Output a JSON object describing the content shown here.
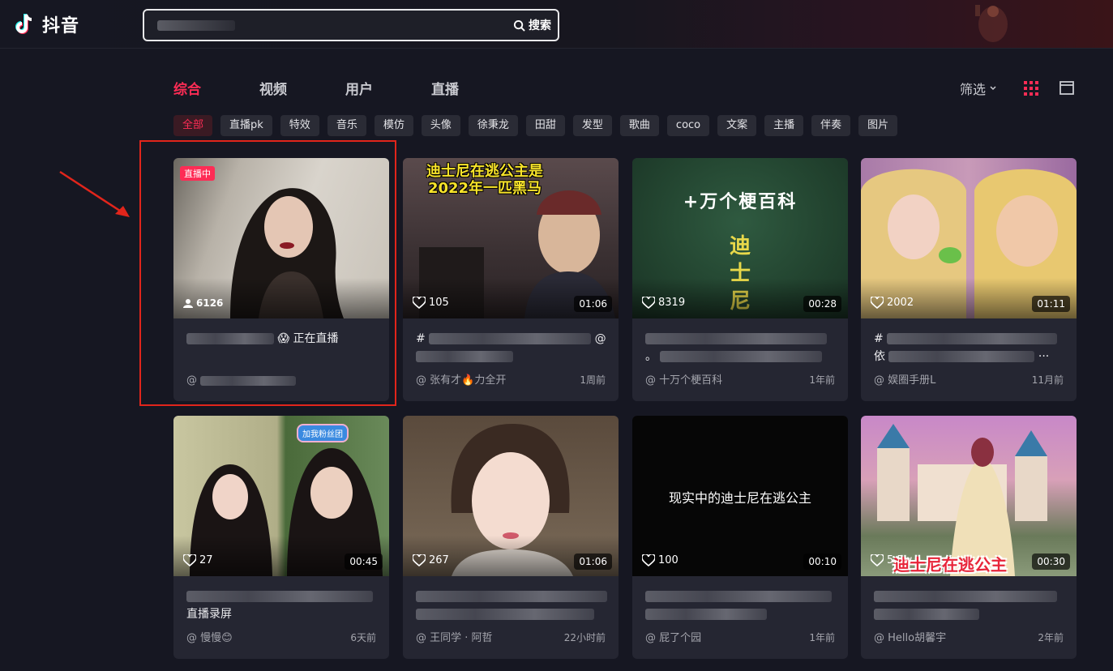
{
  "header": {
    "logo_text": "抖音",
    "search_button": "搜索"
  },
  "tabs": [
    "综合",
    "视频",
    "用户",
    "直播"
  ],
  "toolbar": {
    "filter_label": "筛选"
  },
  "chips": [
    "全部",
    "直播pk",
    "特效",
    "音乐",
    "模仿",
    "头像",
    "徐秉龙",
    "田甜",
    "发型",
    "歌曲",
    "coco",
    "文案",
    "主播",
    "伴奏",
    "图片"
  ],
  "cards": [
    {
      "live_badge": "直播中",
      "count": "6126",
      "title_suffix": "😱 正在直播",
      "author": "@",
      "time": ""
    },
    {
      "count": "105",
      "duration": "01:06",
      "thumb_text_1": "迪士尼在逃公主是",
      "thumb_text_2": "2022年一匹黑马",
      "title_prefix": "#",
      "title_suffix": "@",
      "author": "@ 张有才🔥力全开",
      "time": "1周前"
    },
    {
      "count": "8319",
      "duration": "00:28",
      "thumb_text_1": "+万个梗百科",
      "thumb_text_2": "迪",
      "thumb_text_3": "士",
      "thumb_text_4": "尼",
      "title_prefix": "",
      "title_line2_prefix": "。",
      "author": "@ 十万个梗百科",
      "time": "1年前"
    },
    {
      "count": "2002",
      "duration": "01:11",
      "title_prefix": "#",
      "title_line2_prefix": "依",
      "title_line2_suffix": "···",
      "author": "@ 娱圈手册L",
      "time": "11月前"
    },
    {
      "count": "27",
      "duration": "00:45",
      "thumb_text_1": "加我粉丝团",
      "title_line2": "直播录屏",
      "author": "@ 慢慢😊",
      "time": "6天前"
    },
    {
      "count": "267",
      "duration": "01:06",
      "title_prefix": "",
      "author": "@ 王同学 · 阿哲",
      "time": "22小时前"
    },
    {
      "count": "100",
      "duration": "00:10",
      "thumb_text_1": "现实中的迪士尼在逃公主",
      "author": "@ 屁了个园",
      "time": "1年前"
    },
    {
      "count": "5.5w",
      "duration": "00:30",
      "thumb_text_1": "迪士尼在逃公主",
      "author": "@ Hello胡馨宇",
      "time": "2年前"
    }
  ],
  "colors": {
    "accent": "#fe2c55",
    "background": "#161722",
    "card": "#252632"
  }
}
